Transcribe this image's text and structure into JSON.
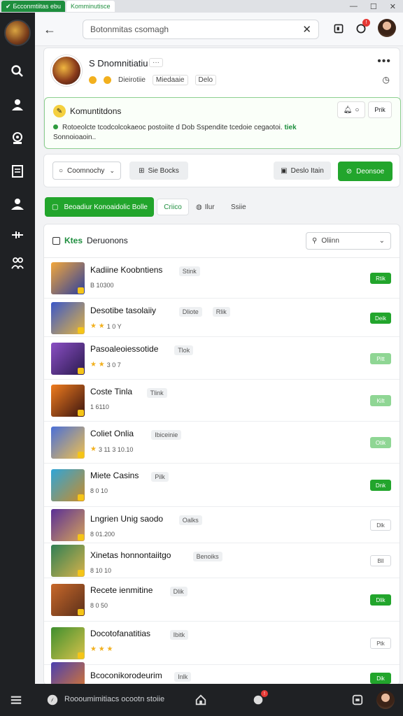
{
  "window": {
    "tab1_label": "Бcconmtiitas ebu",
    "tab2_label": "Komminutisce"
  },
  "search": {
    "value": "Botonmitas csomagh"
  },
  "profile": {
    "name": "S Dnomnitiatiu",
    "dots": "···",
    "meta": {
      "item1": "Dieirotiie",
      "item2": "Miedaaie",
      "item3": "Delo"
    }
  },
  "notice": {
    "title": "Komuntitdons",
    "btn2": "Prik",
    "text": "Rotoeolcte tcodcolcokaeoc postoiite d Dob Sspendite tcedoie cegaotoi.",
    "link": "tiek",
    "text2": "Sonnoioaoin.."
  },
  "actions": {
    "select_label": "Coomnochy",
    "btn2": "Sie Bocks",
    "btn3": "Deslo Itain",
    "btn4": "Deonsoe"
  },
  "filters": {
    "f1": "Beoadiur Konoaidolic Bolle",
    "f2": "Criico",
    "f3": "Ilur",
    "f4": "Ssiie"
  },
  "list": {
    "head_green": "Ktes",
    "head_title": "Deruonons",
    "dropdown": "Oliinn",
    "rows": [
      {
        "title": "Kadiine Koobntiens",
        "tag": "Stink",
        "sub": "B 10300",
        "stars": "",
        "status": "Rtik",
        "status_style": "green",
        "thumb": [
          "#f3a73b",
          "#2c3f9e"
        ]
      },
      {
        "title": "Desotibe tasolaiiy",
        "tag": "Dliote",
        "tag2": "Rlik",
        "sub": "1 0 Y",
        "stars": "★ ★",
        "status": "Deik",
        "status_style": "green",
        "thumb": [
          "#3a57c9",
          "#e2b443"
        ]
      },
      {
        "title": "Pasoaleoiessotide",
        "tag": "Tlok",
        "sub": "3 0 7",
        "stars": "★ ★",
        "status": "Pitt",
        "status_style": "light",
        "thumb": [
          "#8a4fc4",
          "#2b1a4f"
        ]
      },
      {
        "title": "Coste Tinla",
        "tag": "Tlink",
        "sub": "1 6110",
        "stars": "",
        "status": "Kilt",
        "status_style": "light",
        "thumb": [
          "#f07c1e",
          "#3a1410"
        ]
      },
      {
        "title": "Coliet Onlia",
        "tag": "Ibiceinie",
        "sub": "3 11 3 10.10",
        "stars": "★",
        "status": "Otik",
        "status_style": "light",
        "thumb": [
          "#4a6fd8",
          "#f2c14d"
        ]
      },
      {
        "title": "Miete Casins",
        "tag": "Pilk",
        "sub": "8 0 10",
        "stars": "",
        "status": "Dnk",
        "status_style": "green",
        "thumb": [
          "#2fa5d8",
          "#c98c2a"
        ]
      },
      {
        "title": "Lngrien Unig saodo",
        "tag": "Oalks",
        "sub": "8 01.200",
        "stars": "",
        "status": "Dlk",
        "status_style": "gray",
        "thumb": [
          "#5a2f96",
          "#d6a35a"
        ]
      },
      {
        "title": "Xinetas honnontaiitgo",
        "tag": "Benoiks",
        "sub": "8 10 10",
        "stars": "",
        "status": "Bll",
        "status_style": "gray",
        "thumb": [
          "#2f7f55",
          "#d8b24a"
        ]
      },
      {
        "title": "Recete ienmitine",
        "tag": "Dlik",
        "sub": "8 0 50",
        "stars": "",
        "status": "Dlik",
        "status_style": "green",
        "thumb": [
          "#c8682a",
          "#5a2f1a"
        ]
      },
      {
        "title": "Docotofanatitias",
        "tag": "Ibitk",
        "sub": "",
        "stars": "★ ★ ★",
        "status": "Ptk",
        "status_style": "gray",
        "thumb": [
          "#3f8f2f",
          "#d9c24a"
        ]
      },
      {
        "title": "Bcoconikorodeurim",
        "tag": "Inlk",
        "sub": "",
        "stars": "",
        "status": "Dik",
        "status_style": "green",
        "thumb": [
          "#4a3fb0",
          "#e07b2a"
        ]
      }
    ]
  },
  "bottombar": {
    "text": "Roooumimitiacs ocootn stoiie"
  }
}
